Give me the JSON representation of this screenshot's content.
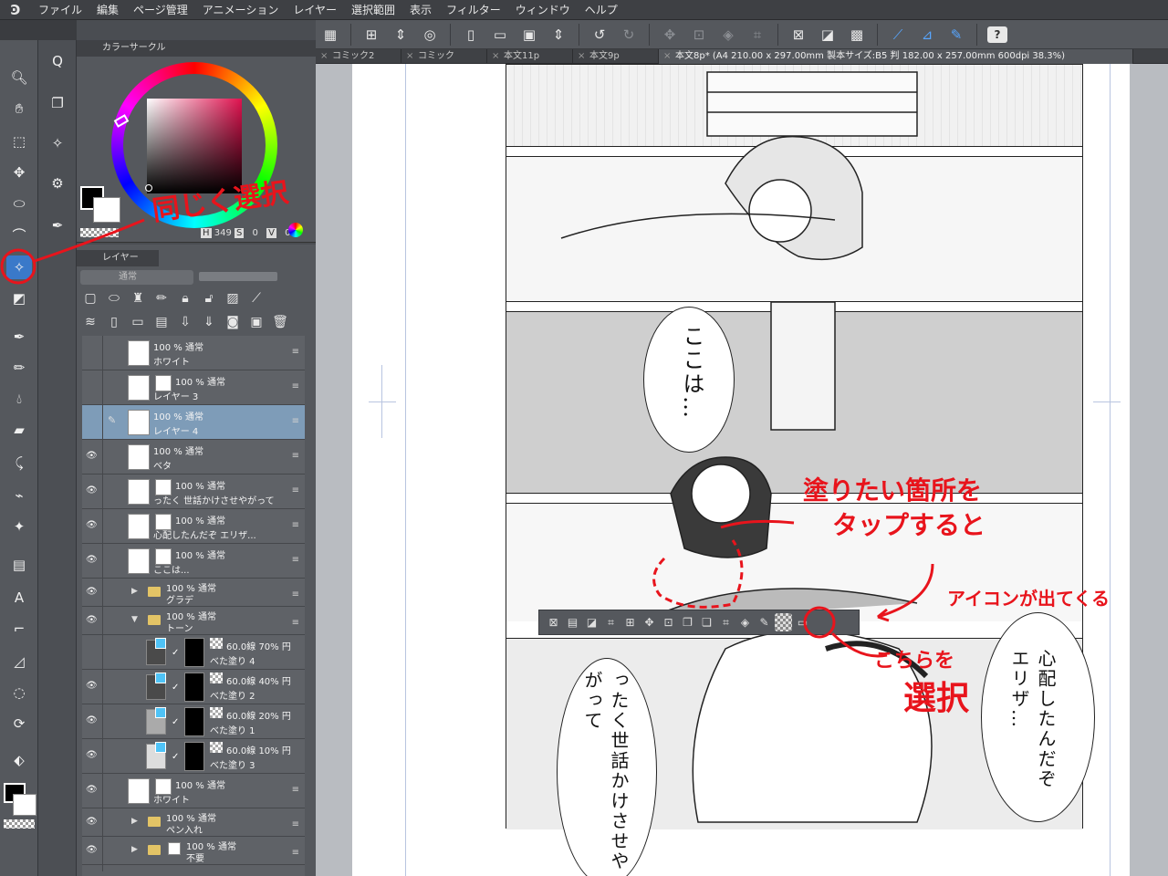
{
  "menubar": {
    "items": [
      "ファイル",
      "編集",
      "ページ管理",
      "アニメーション",
      "レイヤー",
      "選択範囲",
      "表示",
      "フィルター",
      "ウィンドウ",
      "ヘルプ"
    ]
  },
  "tabs": [
    {
      "label": "コミック2"
    },
    {
      "label": "コミック"
    },
    {
      "label": "本文11p"
    },
    {
      "label": "本文9p"
    },
    {
      "label": "本文8p* (A4 210.00 x 297.00mm 製本サイズ:B5 判 182.00 x 257.00mm 600dpi 38.3%)"
    }
  ],
  "color_panel": {
    "title": "カラーサークル",
    "hsv": {
      "h_label": "H",
      "h": "349",
      "s_label": "S",
      "s": "0",
      "v_label": "V",
      "v": "0"
    },
    "accent": "#e0124f"
  },
  "layer_panel": {
    "title": "レイヤー",
    "blend_mode": "通常",
    "layers": [
      {
        "mode": "100 % 通常",
        "name": "ホワイト"
      },
      {
        "mode": "100 % 通常",
        "name": "レイヤー 3"
      },
      {
        "mode": "100 % 通常",
        "name": "レイヤー 4"
      },
      {
        "mode": "100 % 通常",
        "name": "ベタ"
      },
      {
        "mode": "100 % 通常",
        "name": "ったく 世話かけさせやがって"
      },
      {
        "mode": "100 % 通常",
        "name": "心配したんだぞ エリザ..."
      },
      {
        "mode": "100 % 通常",
        "name": "ここは..."
      },
      {
        "mode": "100 % 通常",
        "name": "グラデ"
      },
      {
        "mode": "100 % 通常",
        "name": "トーン"
      },
      {
        "mode": "60.0線 70% 円",
        "name": "べた塗り 4"
      },
      {
        "mode": "60.0線 40% 円",
        "name": "べた塗り 2"
      },
      {
        "mode": "60.0線 20% 円",
        "name": "べた塗り 1"
      },
      {
        "mode": "60.0線 10% 円",
        "name": "べた塗り 3"
      },
      {
        "mode": "100 % 通常",
        "name": "ホワイト"
      },
      {
        "mode": "100 % 通常",
        "name": "ペン入れ"
      },
      {
        "mode": "100 % 通常",
        "name": "不要"
      }
    ]
  },
  "manga": {
    "bubble_1": "ここは…",
    "bubble_2": "心配したんだぞエリザ…",
    "bubble_3": "ったく世話かけさせやがって"
  },
  "annotations": {
    "same_selection": "同じく選択",
    "tap_line1": "塗りたい箇所を",
    "tap_line2": "タップすると",
    "icon_appears": "アイコンが出てくる",
    "select_this_1": "こちらを",
    "select_this_2": "選択",
    "color": "#e8141c"
  },
  "help": {
    "label": "?"
  }
}
